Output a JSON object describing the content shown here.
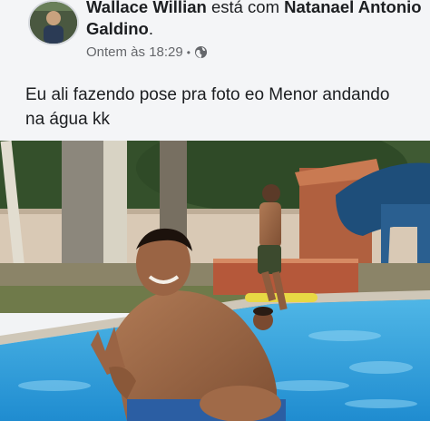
{
  "post": {
    "author": "Wallace Willian",
    "connector": " está com ",
    "tagged": "Natanael Antonio Galdino",
    "title_end": ".",
    "time": "Ontem às 18:29",
    "separator": "•",
    "privacy_icon": "globe-icon",
    "caption": "Eu ali fazendo pose pra foto eo Menor andando na água kk"
  },
  "colors": {
    "text_primary": "#1c1e21",
    "text_secondary": "#65676b",
    "pool_water": "#3fa7e0"
  }
}
